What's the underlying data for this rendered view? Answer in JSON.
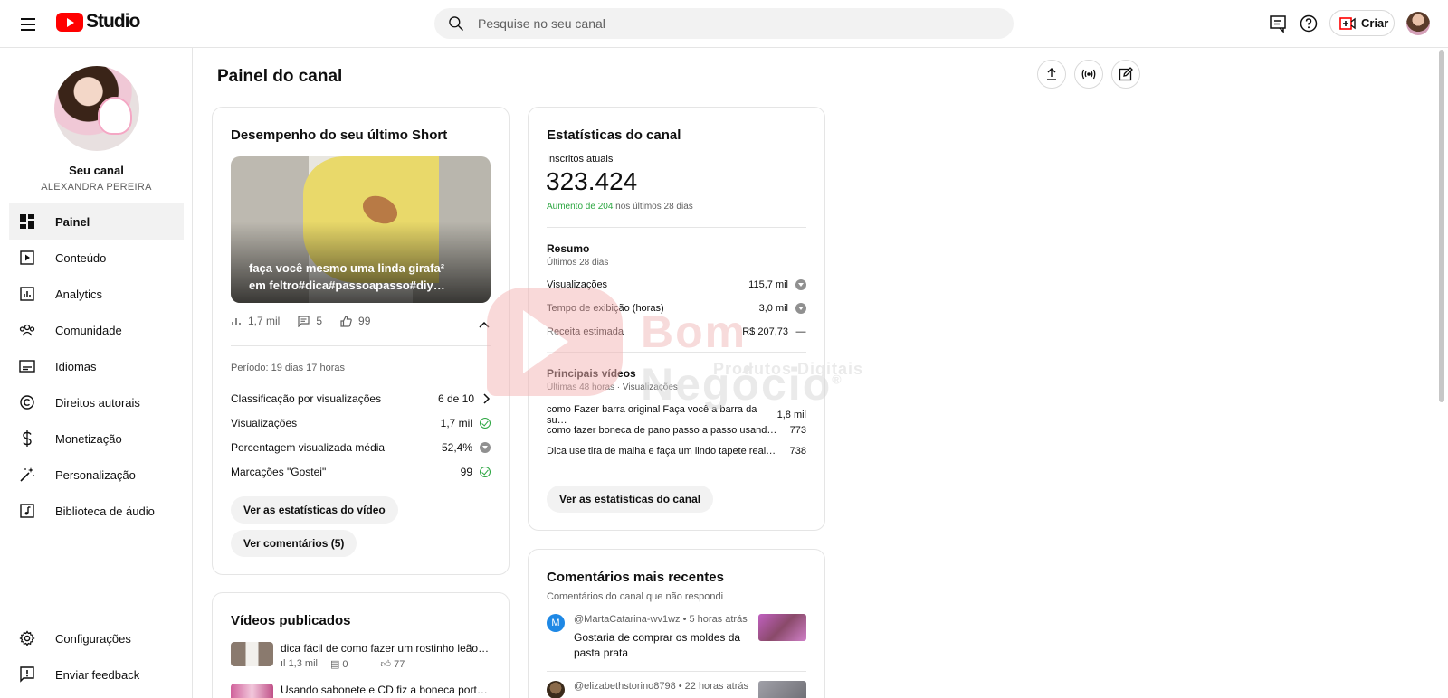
{
  "topbar": {
    "logo_text": "Studio",
    "search_placeholder": "Pesquise no seu canal",
    "create_label": "Criar"
  },
  "sidebar": {
    "channel_label": "Seu canal",
    "channel_name": "ALEXANDRA PEREIRA",
    "items": [
      {
        "label": "Painel",
        "icon": "dashboard-icon",
        "active": true
      },
      {
        "label": "Conteúdo",
        "icon": "content-icon"
      },
      {
        "label": "Analytics",
        "icon": "analytics-icon"
      },
      {
        "label": "Comunidade",
        "icon": "community-icon"
      },
      {
        "label": "Idiomas",
        "icon": "subtitles-icon"
      },
      {
        "label": "Direitos autorais",
        "icon": "copyright-icon"
      },
      {
        "label": "Monetização",
        "icon": "dollar-icon"
      },
      {
        "label": "Personalização",
        "icon": "magic-wand-icon"
      },
      {
        "label": "Biblioteca de áudio",
        "icon": "audio-library-icon"
      }
    ],
    "bottom_items": [
      {
        "label": "Configurações",
        "icon": "gear-icon"
      },
      {
        "label": "Enviar feedback",
        "icon": "feedback-icon"
      }
    ]
  },
  "page": {
    "title": "Painel do canal"
  },
  "short_card": {
    "title": "Desempenho do seu último Short",
    "caption": "faça você mesmo uma linda girafa² em feltro#dica#passoapasso#diy…",
    "views": "1,7 mil",
    "comments": "5",
    "likes": "99",
    "period": "Período: 19 dias 17 horas",
    "rows": [
      {
        "label": "Classificação por visualizações",
        "value": "6 de 10"
      },
      {
        "label": "Visualizações",
        "value": "1,7 mil"
      },
      {
        "label": "Porcentagem visualizada média",
        "value": "52,4%"
      },
      {
        "label": "Marcações \"Gostei\"",
        "value": "99"
      }
    ],
    "btn_stats": "Ver as estatísticas do vídeo",
    "btn_comments": "Ver comentários (5)"
  },
  "published_card": {
    "title": "Vídeos publicados",
    "videos": [
      {
        "title": "dica fácil de como fazer um rostinho leãozinho…",
        "views": "1,3 mil",
        "comments": "0",
        "likes": "77"
      },
      {
        "title": "Usando sabonete e CD fiz a boneca porta celul…",
        "views": "",
        "comments": "",
        "likes": ""
      }
    ]
  },
  "stats_card": {
    "title": "Estatísticas do canal",
    "subs_label": "Inscritos atuais",
    "subs_value": "323.424",
    "growth_green": "Aumento de 204",
    "growth_rest": " nos últimos 28 dias",
    "summary_title": "Resumo",
    "summary_sub": "Últimos 28 dias",
    "summary_rows": [
      {
        "label": "Visualizações",
        "value": "115,7 mil"
      },
      {
        "label": "Tempo de exibição (horas)",
        "value": "3,0 mil"
      },
      {
        "label": "Receita estimada",
        "value": "R$ 207,73"
      }
    ],
    "top_title": "Principais vídeos",
    "top_sub": "Últimas 48 horas · Visualizações",
    "top_videos": [
      {
        "title": "como Fazer barra original Faça você a barra da su…",
        "value": "1,8 mil"
      },
      {
        "title": "como fazer boneca de pano passo a passo usand…",
        "value": "773"
      },
      {
        "title": "Dica use tira de malha e faça um lindo tapete real…",
        "value": "738"
      }
    ],
    "btn": "Ver as estatísticas do canal"
  },
  "comments_card": {
    "title": "Comentários mais recentes",
    "subtitle": "Comentários do canal que não respondi",
    "comments": [
      {
        "author": "@MartaCatarina-wv1wz",
        "time": " • 5 horas atrás",
        "text": "Gostaria de comprar os moldes da pasta prata",
        "avatar_letter": "M"
      },
      {
        "author": "@elizabethstorino8798",
        "time": " • 22 horas atrás",
        "text": "",
        "avatar_letter": ""
      }
    ]
  },
  "watermark": {
    "brand_a": "Bom ",
    "brand_b": "Negócio",
    "mark": "®",
    "sub": "Produtos Digitais"
  },
  "colors": {
    "brand_red": "#ff0000",
    "growth_green": "#2ba640",
    "avatar_blue": "#1e88e5"
  }
}
